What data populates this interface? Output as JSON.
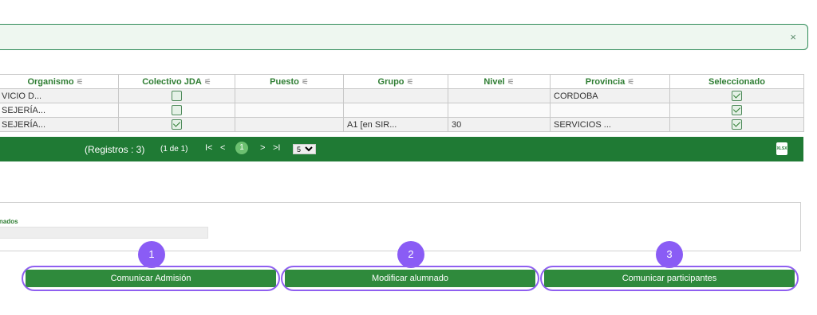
{
  "alert": {
    "close": "×"
  },
  "table": {
    "headers": {
      "organismo": "Organismo",
      "colectivo": "Colectivo JDA",
      "puesto": "Puesto",
      "grupo": "Grupo",
      "nivel": "Nivel",
      "provincia": "Provincia",
      "seleccionado": "Seleccionado"
    },
    "rows": [
      {
        "organismo": "VICIO D...",
        "colectivo_checked": false,
        "puesto": "",
        "grupo": "",
        "nivel": "",
        "provincia": "CORDOBA",
        "seleccionado_checked": true
      },
      {
        "organismo": "SEJERÍA...",
        "colectivo_checked": false,
        "puesto": "",
        "grupo": "",
        "nivel": "",
        "provincia": "",
        "seleccionado_checked": true
      },
      {
        "organismo": "SEJERÍA...",
        "colectivo_checked": true,
        "puesto": "",
        "grupo": "A1 [en SIR...",
        "nivel": "30",
        "provincia": "SERVICIOS ...",
        "seleccionado_checked": true
      }
    ]
  },
  "pager": {
    "count_text": "(Registros : 3)",
    "pages_text": "(1 de 1)",
    "first": "I<",
    "prev": "<",
    "current": "1",
    "next": ">",
    "last": ">I",
    "page_size": "5",
    "export_label": "XLSX"
  },
  "panel": {
    "label": "nados"
  },
  "actions": [
    {
      "badge": "1",
      "label": "Comunicar Admisión"
    },
    {
      "badge": "2",
      "label": "Modificar alumnado"
    },
    {
      "badge": "3",
      "label": "Comunicar participantes"
    }
  ],
  "colors": {
    "primary_green": "#2f8a3c",
    "pager_green": "#1f7a34",
    "highlight_purple": "#8a5cf5"
  }
}
